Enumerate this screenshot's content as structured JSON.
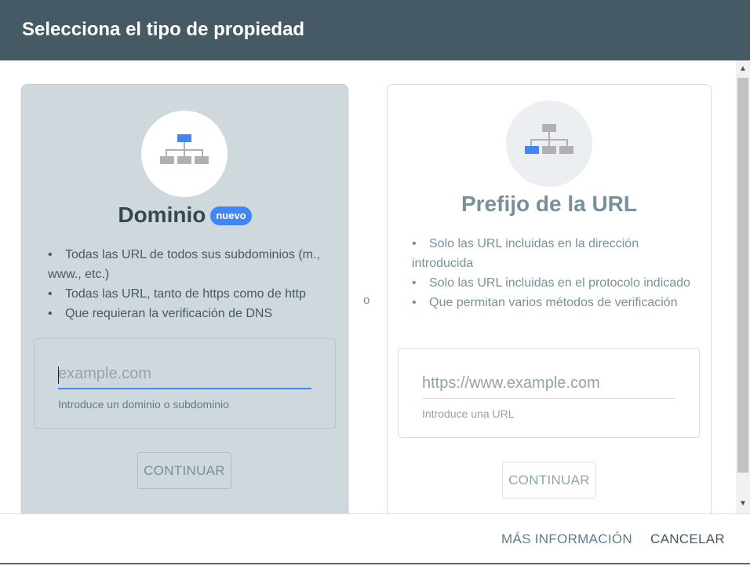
{
  "dialog": {
    "title": "Selecciona el tipo de propiedad"
  },
  "domain_card": {
    "title": "Dominio",
    "badge": "nuevo",
    "features": [
      "Todas las URL de todos sus subdominios (m., www., etc.)",
      "Todas las URL, tanto de https como de http",
      "Que requieran la verificación de DNS"
    ],
    "input": {
      "value": "",
      "placeholder": "example.com"
    },
    "hint": "Introduce un dominio o subdominio",
    "continue_label": "CONTINUAR"
  },
  "separator": "o",
  "url_card": {
    "title": "Prefijo de la URL",
    "features": [
      "Solo las URL incluidas en la dirección introducida",
      "Solo las URL incluidas en el protocolo indicado",
      "Que permitan varios métodos de verificación"
    ],
    "input": {
      "value": "",
      "placeholder": "https://www.example.com"
    },
    "hint": "Introduce una URL",
    "continue_label": "CONTINUAR"
  },
  "footer": {
    "more_info_label": "MÁS INFORMACIÓN",
    "cancel_label": "CANCELAR"
  },
  "icons": {
    "domain_card_icon": "sitemap-icon-top-highlighted",
    "url_card_icon": "sitemap-icon-leaf-highlighted",
    "scroll_up": "arrow-up-icon",
    "scroll_down": "arrow-down-icon"
  },
  "colors": {
    "header_bg": "#455a64",
    "accent": "#4285f4",
    "selected_card_bg": "#cfd8dc"
  }
}
